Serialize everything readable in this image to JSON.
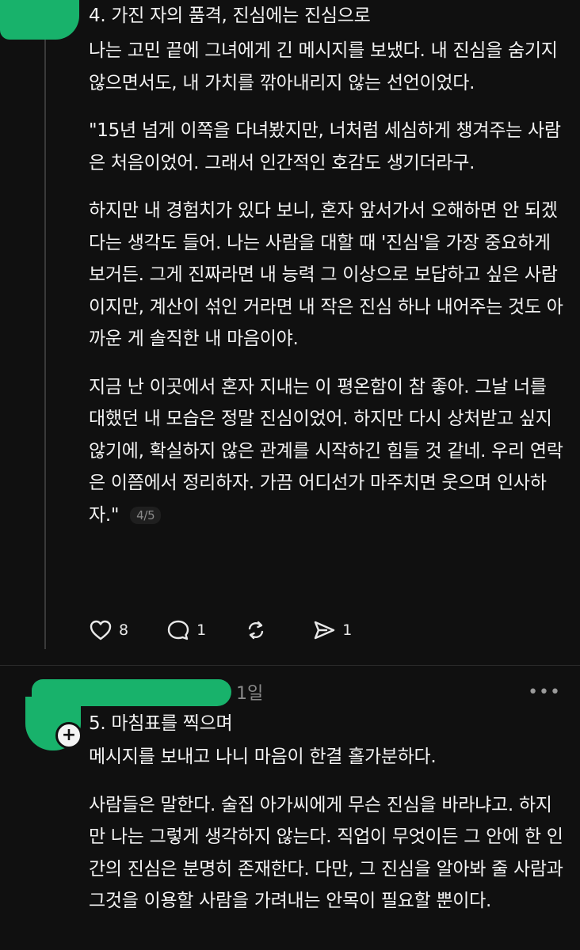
{
  "post1": {
    "title": "4. 가진 자의 품격, 진심에는 진심으로",
    "paragraphs": [
      "나는 고민 끝에 그녀에게 긴 메시지를 보냈다. 내 진심을 숨기지 않으면서도, 내 가치를 깎아내리지 않는 선언이었다.",
      "\"15년 넘게 이쪽을 다녀봤지만, 너처럼 세심하게 챙겨주는 사람은 처음이었어. 그래서 인간적인 호감도 생기더라구.",
      "하지만 내 경험치가 있다 보니, 혼자 앞서가서 오해하면 안 되겠다는 생각도 들어. 나는 사람을 대할 때 '진심'을 가장 중요하게 보거든. 그게 진짜라면 내 능력 그 이상으로 보답하고 싶은 사람이지만, 계산이 섞인 거라면 내 작은 진심 하나 내어주는 것도 아까운 게 솔직한 내 마음이야.",
      "지금 난 이곳에서 혼자 지내는 이 평온함이 참 좋아. 그날 너를 대했던 내 모습은 정말 진심이었어. 하지만 다시 상처받고 싶지 않기에, 확실하지 않은 관계를 시작하긴 힘들 것 같네. 우리 연락은 이쯤에서 정리하자. 가끔 어디선가 마주치면 웃으며 인사하자.\""
    ],
    "page_indicator": "4/5",
    "actions": {
      "likes": "8",
      "comments": "1",
      "reposts": "",
      "shares": "1"
    }
  },
  "post2": {
    "time_fragment": "1일",
    "more_label": "•••",
    "plus_label": "+",
    "title": "5. 마침표를 찍으며",
    "paragraphs": [
      "메시지를 보내고 나니 마음이 한결 홀가분하다.",
      "사람들은 말한다. 술집 아가씨에게 무슨 진심을 바라냐고. 하지만 나는 그렇게 생각하지 않는다. 직업이 무엇이든 그 안에 한 인간의 진심은 분명히 존재한다. 다만, 그 진심을 알아봐 줄 사람과 그것을 이용할 사람을 가려내는 안목이 필요할 뿐이다."
    ]
  },
  "colors": {
    "background": "#101010",
    "text": "#f3f3f3",
    "muted": "#8a8a8a",
    "redaction": "#18b26b"
  }
}
